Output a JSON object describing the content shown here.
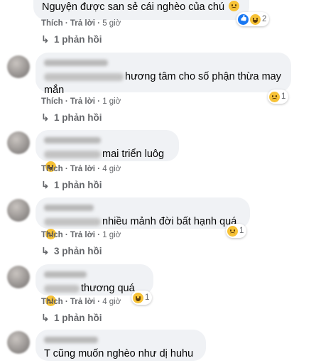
{
  "actions": {
    "like": "Thích",
    "reply": "Trả lời",
    "separator": "·"
  },
  "comments": [
    {
      "text": "Nguyện được san sẻ cái nghèo của chú",
      "emoji": "sad-face-icon",
      "time": "5 giờ",
      "reactions": {
        "icons": [
          "like-icon",
          "haha-icon"
        ],
        "count": "2"
      },
      "replies": "1 phản hồi"
    },
    {
      "text_line1": "hương tâm cho số phận thừa may",
      "text_line2": "mắn",
      "time": "1 giờ",
      "reactions": {
        "icons": [
          "sad-icon"
        ],
        "count": "1"
      },
      "replies": "1 phản hồi"
    },
    {
      "text": "mai triển luôg",
      "emoji": "haha-icon",
      "time": "4 giờ",
      "replies": "1 phản hồi"
    },
    {
      "text": "nhiều mảnh đời bất hạnh quá",
      "emoji": "sad-face-icon",
      "time": "1 giờ",
      "reactions": {
        "icons": [
          "sad-icon"
        ],
        "count": "1"
      },
      "replies": "3 phản hồi"
    },
    {
      "text": "thương quá",
      "emoji": "sad-face-icon",
      "time": "4 giờ",
      "reactions": {
        "icons": [
          "haha-icon"
        ],
        "count": "1"
      },
      "replies": "1 phản hồi"
    },
    {
      "text": "T cũng muốn nghèo như dị huhu"
    }
  ],
  "colors": {
    "bubble": "#f0f2f5",
    "meta": "#65676b",
    "text": "#050505",
    "like_blue": "#1877f2",
    "emoji_yellow": "#f7c236"
  }
}
